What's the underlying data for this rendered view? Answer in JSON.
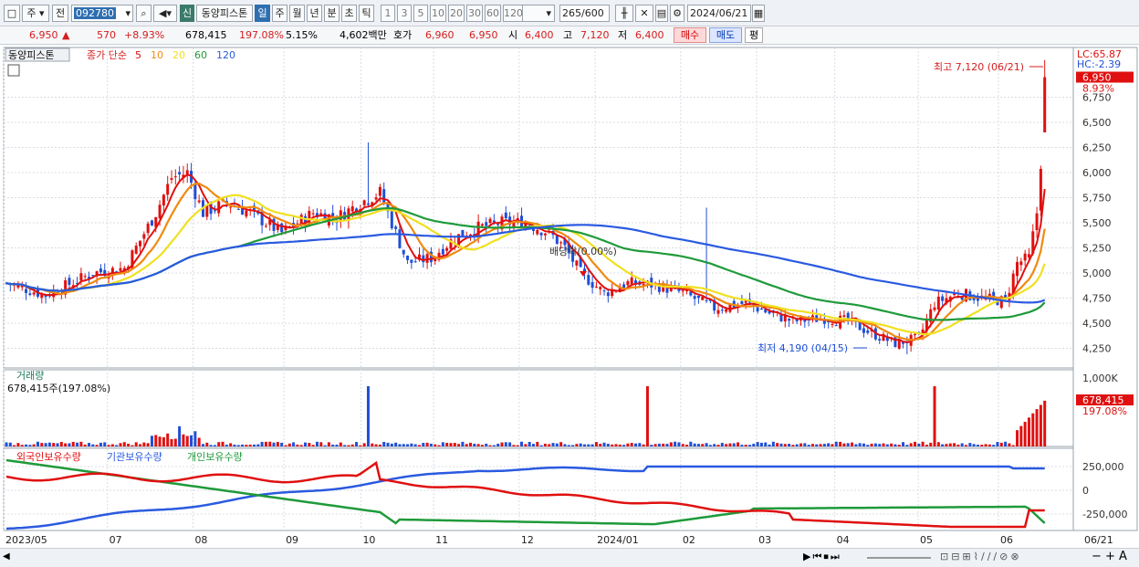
{
  "toolbar": {
    "market": "주",
    "prefix": "전",
    "code": "092780",
    "name_badge": "신",
    "stock_name": "동양피스톤",
    "periods": [
      "일",
      "주",
      "월",
      "년",
      "분",
      "초",
      "틱"
    ],
    "active_period": "일",
    "intervals": [
      "1",
      "3",
      "5",
      "10",
      "20",
      "30",
      "60",
      "120"
    ],
    "count": "265",
    "count_total": "/600",
    "date": "2024/06/21"
  },
  "info": {
    "price": "6,950",
    "change_arrow": "▲",
    "change": "570",
    "change_pct": "+8.93%",
    "volume": "678,415",
    "volume_ratio": "197.08%",
    "turnover": "5.15%",
    "amount": "4,602백만",
    "quote_label": "호가",
    "ask": "6,960",
    "bid": "6,950",
    "open_label": "시",
    "open": "6,400",
    "high_label": "고",
    "high": "7,120",
    "low_label": "저",
    "low": "6,400",
    "buy": "매수",
    "sell": "매도",
    "even": "평"
  },
  "price_panel": {
    "title": "동양피스톤",
    "legend_prefix": "종가 단순",
    "ma_labels": [
      "5",
      "10",
      "20",
      "60",
      "120"
    ],
    "ma_colors": [
      "#e01010",
      "#f08a10",
      "#f0e020",
      "#1f9a3a",
      "#2a5ae0"
    ],
    "lc": "LC:65.87",
    "hc": "HC:-2.39",
    "current": "6,950",
    "current_pct": "8.93%",
    "y_ticks": [
      "6,750",
      "6,500",
      "6,250",
      "6,000",
      "5,750",
      "5,500",
      "5,250",
      "5,000",
      "4,750",
      "4,500",
      "4,250"
    ],
    "high_note": "최고 7,120 (06/21)",
    "low_note": "최저 4,190 (04/15)",
    "dividend_note": "배당락(0.00%)"
  },
  "volume_panel": {
    "title": "거래량",
    "subtitle": "678,415주(197.08%)",
    "y_tick": "1,000K",
    "current": "678,415",
    "current_pct": "197.08%"
  },
  "holding_panel": {
    "legends": [
      "외국인보유수량",
      "기관보유수량",
      "개인보유수량"
    ],
    "legend_colors": [
      "#e01010",
      "#2a5ae0",
      "#1f9a3a"
    ],
    "y_ticks": [
      "250,000",
      "0",
      "-250,000"
    ]
  },
  "x_axis": [
    "2023/05",
    "07",
    "08",
    "09",
    "10",
    "11",
    "12",
    "2024/01",
    "02",
    "03",
    "04",
    "05",
    "06"
  ],
  "x_last": "06/21",
  "chart_data": {
    "type": "candlestick",
    "title": "동양피스톤",
    "x": [
      "2023/05",
      "07",
      "08",
      "09",
      "10",
      "11",
      "12",
      "2024/01",
      "02",
      "03",
      "04",
      "05",
      "06",
      "06/21"
    ],
    "close": [
      4900,
      5000,
      5700,
      5650,
      5200,
      5450,
      4800,
      4900,
      4650,
      4500,
      4300,
      4750,
      5100,
      6950
    ],
    "ma_periods": [
      5,
      10,
      20,
      60,
      120
    ],
    "ylim": [
      4100,
      7200
    ],
    "high": 7120,
    "low": 4190
  }
}
